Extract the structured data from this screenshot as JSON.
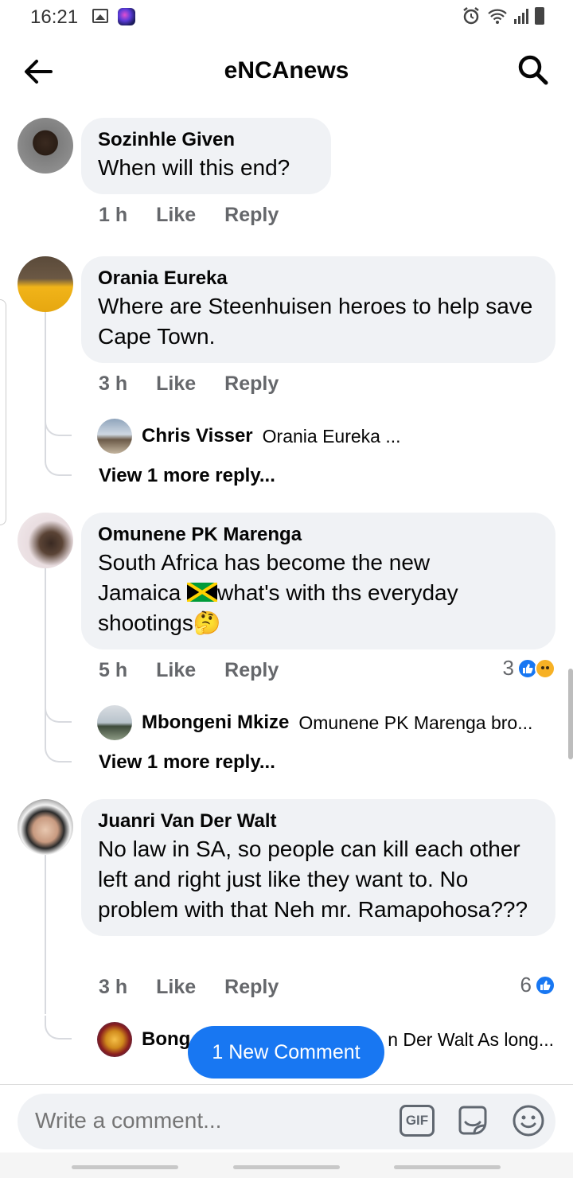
{
  "status_bar": {
    "time": "16:21"
  },
  "header": {
    "title": "eNCAnews"
  },
  "comments": [
    {
      "author": "Sozinhle Given",
      "text": "When will this end?",
      "time": "1 h",
      "like": "Like",
      "reply": "Reply"
    },
    {
      "author": "Orania Eureka",
      "text": "Where are Steenhuisen heroes to help save Cape Town.",
      "time": "3 h",
      "like": "Like",
      "reply": "Reply",
      "reply_preview": {
        "author": "Chris Visser",
        "snippet": "Orania Eureka ..."
      },
      "view_more": "View 1 more reply..."
    },
    {
      "author": "Omunene PK Marenga",
      "text_line1": "South Africa has become the new",
      "text_line2a": "Jamaica ",
      "text_line2b": "what's with ths everyday",
      "text_line3": "shootings",
      "emoji": "🤔",
      "time": "5 h",
      "like": "Like",
      "reply": "Reply",
      "reaction_count": "3",
      "reply_preview": {
        "author": "Mbongeni Mkize",
        "snippet": "Omunene PK Marenga bro..."
      },
      "view_more": "View 1 more reply..."
    },
    {
      "author": "Juanri Van Der Walt",
      "text": "No law in SA, so people can kill each other left and right just like they want to. No problem with that Neh mr. Ramapohosa???",
      "time": "3 h",
      "like": "Like",
      "reply": "Reply",
      "reaction_count": "6",
      "reply_preview": {
        "author": "Bong",
        "snippet": "n Der Walt As long..."
      }
    }
  ],
  "new_comment_pill": "1 New Comment",
  "composer": {
    "placeholder": "Write a comment...",
    "gif": "GIF"
  },
  "colors": {
    "accent": "#1877f2",
    "bubble": "#f0f2f5",
    "muted": "#65676b"
  }
}
